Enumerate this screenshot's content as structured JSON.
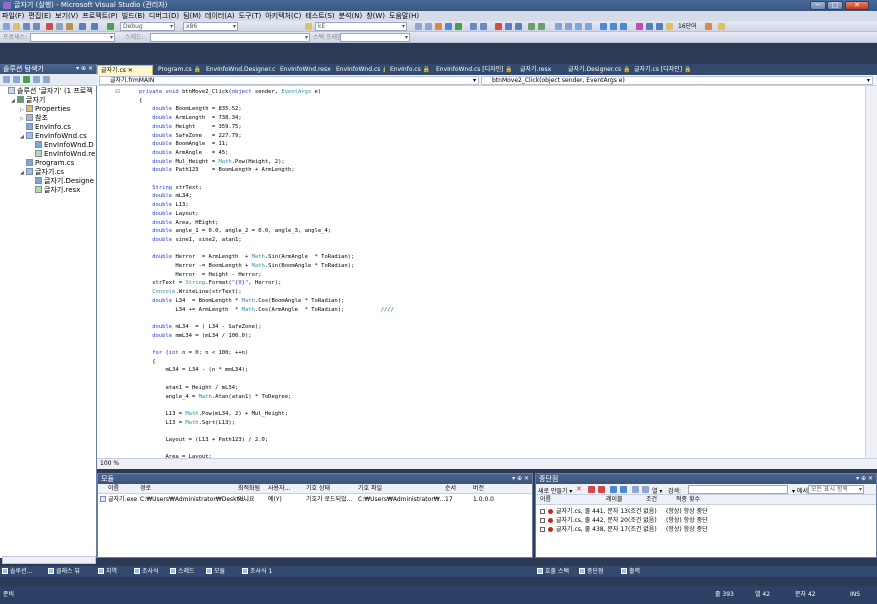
{
  "window": {
    "title": "글자기 (실행) - Microsoft Visual Studio (관리자)",
    "min_label": "─",
    "max_label": "□",
    "close_label": "✕"
  },
  "menu": [
    "파일(F)",
    "편집(E)",
    "보기(V)",
    "프로젝트(P)",
    "빌드(B)",
    "디버그(D)",
    "팀(M)",
    "데이터(A)",
    "도구(T)",
    "아키텍처(C)",
    "테스트(S)",
    "분석(N)",
    "창(W)",
    "도움말(H)"
  ],
  "toolbar": {
    "config_combo": "Debug",
    "platform_combo": "x86",
    "find_combo": "kE",
    "font_size_label": "16단어",
    "row3_combo1": "프로세스:",
    "row3_combo2": "스레드:",
    "row3_combo3": "스택 프레임:"
  },
  "solution_explorer": {
    "title": "솔루션 탐색기",
    "controls": "▾ ⊕ ✕",
    "nodes": [
      {
        "label": "솔루션 '글자기' (1 프로젝",
        "depth": 0,
        "icon": "solution-icon",
        "exp": ""
      },
      {
        "label": "글자기",
        "depth": 1,
        "icon": "project-icon",
        "exp": "◢"
      },
      {
        "label": "Properties",
        "depth": 2,
        "icon": "properties-icon",
        "exp": "▷"
      },
      {
        "label": "참조",
        "depth": 2,
        "icon": "references-icon",
        "exp": "▷"
      },
      {
        "label": "EnvInfo.cs",
        "depth": 2,
        "icon": "cs-file-icon",
        "exp": ""
      },
      {
        "label": "EnvInfoWnd.cs",
        "depth": 2,
        "icon": "form-icon",
        "exp": "◢"
      },
      {
        "label": "EnvInfoWnd.D",
        "depth": 3,
        "icon": "cs-file-icon",
        "exp": ""
      },
      {
        "label": "EnvInfoWnd.re",
        "depth": 3,
        "icon": "resx-icon",
        "exp": ""
      },
      {
        "label": "Program.cs",
        "depth": 2,
        "icon": "cs-file-icon",
        "exp": ""
      },
      {
        "label": "글자기.cs",
        "depth": 2,
        "icon": "form-icon",
        "exp": "◢"
      },
      {
        "label": "글자기.Designe",
        "depth": 3,
        "icon": "cs-file-icon",
        "exp": ""
      },
      {
        "label": "글자기.resx",
        "depth": 3,
        "icon": "resx-icon",
        "exp": ""
      }
    ]
  },
  "editor": {
    "tabs": [
      {
        "label": "글자기.cs ✕",
        "active": true
      },
      {
        "label": "Program.cs 🔒",
        "active": false
      },
      {
        "label": "EnvInfoWnd.Designer.cs 🔒",
        "active": false
      },
      {
        "label": "EnvInfoWnd.resx",
        "active": false
      },
      {
        "label": "EnvInfoWnd.cs 🔒",
        "active": false
      },
      {
        "label": "EnvInfo.cs 🔒",
        "active": false
      },
      {
        "label": "EnvInfoWnd.cs [디자인] 🔒",
        "active": false
      },
      {
        "label": "글자기.resx",
        "active": false
      },
      {
        "label": "글자기.Designer.cs 🔒",
        "active": false
      },
      {
        "label": "글자기.cs [디자인] 🔒",
        "active": false
      }
    ],
    "nav_left": "글자기.frmMAIN",
    "nav_right": "btnMove2_Click(object sender, EventArgs e)",
    "zoom": "100 %",
    "code_lines": [
      [
        [
          "kw",
          "private "
        ],
        [
          "kw",
          "void "
        ],
        [
          "",
          "btnMove2_Click("
        ],
        [
          "kw",
          "object "
        ],
        [
          "",
          "sender, "
        ],
        [
          "ty",
          "EventArgs "
        ],
        [
          "",
          "e)"
        ]
      ],
      [
        [
          "",
          "{"
        ]
      ],
      [
        [
          "kw",
          "    double "
        ],
        [
          "",
          "BoomLength = 835.52;"
        ]
      ],
      [
        [
          "kw",
          "    double "
        ],
        [
          "",
          "ArmLength  = 738.34;"
        ]
      ],
      [
        [
          "kw",
          "    double "
        ],
        [
          "",
          "Height     = 359.75;"
        ]
      ],
      [
        [
          "kw",
          "    double "
        ],
        [
          "",
          "SafeZone   = 227.79;"
        ]
      ],
      [
        [
          "kw",
          "    double "
        ],
        [
          "",
          "BoomAngle  = 11;"
        ]
      ],
      [
        [
          "kw",
          "    double "
        ],
        [
          "",
          "ArmAngle   = 45;"
        ]
      ],
      [
        [
          "kw",
          "    double "
        ],
        [
          "",
          "Mul_Height = "
        ],
        [
          "ty",
          "Math"
        ],
        [
          "",
          ".Pow(Height, 2);"
        ]
      ],
      [
        [
          "kw",
          "    double "
        ],
        [
          "",
          "Path123    = BoomLength + ArmLength;"
        ]
      ],
      [
        [
          "",
          ""
        ]
      ],
      [
        [
          "kw",
          "    String "
        ],
        [
          "",
          "strText;"
        ]
      ],
      [
        [
          "kw",
          "    double "
        ],
        [
          "",
          "mL34;"
        ]
      ],
      [
        [
          "kw",
          "    double "
        ],
        [
          "",
          "L13;"
        ]
      ],
      [
        [
          "kw",
          "    double "
        ],
        [
          "",
          "Layout;"
        ]
      ],
      [
        [
          "kw",
          "    double "
        ],
        [
          "",
          "Area, HEight;"
        ]
      ],
      [
        [
          "kw",
          "    double "
        ],
        [
          "",
          "angle_1 = 0.0, angle_2 = 0.0, angle_3, angle_4;"
        ]
      ],
      [
        [
          "kw",
          "    double "
        ],
        [
          "",
          "sine1, sine2, atan1;"
        ]
      ],
      [
        [
          "",
          ""
        ]
      ],
      [
        [
          "kw",
          "    double "
        ],
        [
          "",
          "Herror  = ArmLength  + "
        ],
        [
          "ty",
          "Math"
        ],
        [
          "",
          ".Sin(ArmAngle  * ToRadian);"
        ]
      ],
      [
        [
          "",
          "           Herror -= BoomLength + "
        ],
        [
          "ty",
          "Math"
        ],
        [
          "",
          ".Sin(BoomAngle * ToRadian);"
        ]
      ],
      [
        [
          "",
          "           Herror  = Height - Herror;"
        ]
      ],
      [
        [
          "",
          "    strText = "
        ],
        [
          "ty",
          "String"
        ],
        [
          "",
          ".Format("
        ],
        [
          "kw",
          "\"{0}\""
        ],
        [
          "",
          ", Herror);"
        ]
      ],
      [
        [
          "ty",
          "    Console"
        ],
        [
          "",
          ".WriteLine(strText);"
        ]
      ],
      [
        [
          "kw",
          "    double "
        ],
        [
          "",
          "L34  = BoomLength * "
        ],
        [
          "ty",
          "Math"
        ],
        [
          "",
          ".Cos(BoomAngle * ToRadian);"
        ]
      ],
      [
        [
          "",
          "           L34 += ArmLength  * "
        ],
        [
          "ty",
          "Math"
        ],
        [
          "",
          ".Cos(ArmAngle  * ToRadian);"
        ],
        [
          "cm",
          "           ////"
        ]
      ],
      [
        [
          "",
          ""
        ]
      ],
      [
        [
          "kw",
          "    double "
        ],
        [
          "",
          "mL34  = ( L34 - SafeZone);"
        ]
      ],
      [
        [
          "kw",
          "    double "
        ],
        [
          "",
          "mmL34 = (mL34 / 100.0);"
        ]
      ],
      [
        [
          "",
          ""
        ]
      ],
      [
        [
          "kw",
          "    for "
        ],
        [
          "",
          "("
        ],
        [
          "kw",
          "int "
        ],
        [
          "",
          "n = 0; n < 100; ++n)"
        ]
      ],
      [
        [
          "",
          "    {"
        ]
      ],
      [
        [
          "",
          "        mL34 = L34 - (n * mmL34);"
        ]
      ],
      [
        [
          "",
          ""
        ]
      ],
      [
        [
          "",
          "        atan1 = Height / mL34;"
        ]
      ],
      [
        [
          "",
          "        angle_4 = "
        ],
        [
          "ty",
          "Math"
        ],
        [
          "",
          ".Atan(atan1) * ToDegree;"
        ]
      ],
      [
        [
          "",
          ""
        ]
      ],
      [
        [
          "",
          "        L13 = "
        ],
        [
          "ty",
          "Math"
        ],
        [
          "",
          ".Pow(mL34, 2) + Mul_Height;"
        ]
      ],
      [
        [
          "",
          "        L13 = "
        ],
        [
          "ty",
          "Math"
        ],
        [
          "",
          ".Sqrt(L13);"
        ]
      ],
      [
        [
          "",
          ""
        ]
      ],
      [
        [
          "",
          "        Layout = (L13 + Path123) / 2.0;"
        ]
      ],
      [
        [
          "",
          ""
        ]
      ],
      [
        [
          "",
          "        Area = Layout;"
        ]
      ]
    ]
  },
  "output_panel": {
    "title": "모듈",
    "controls": "▾ ⊕ ✕",
    "columns": [
      "이름",
      "경로",
      "최적화됨",
      "사용자...",
      "기호 상태",
      "기호 파일",
      "순서",
      "버전"
    ],
    "rows": [
      [
        "글자기.exe",
        "C:₩Users₩Administrator₩Deskto...",
        "아니요",
        "예(Y)",
        "기호가 로드되었...",
        "C:₩Users₩Administrator₩...",
        "17",
        "1.0.0.0"
      ]
    ]
  },
  "breakpoint_panel": {
    "title": "중단점",
    "controls": "▾ ⊕ ✕",
    "toolbar_new": "새로 만들기 ▾",
    "toolbar_columns": "열 ▾",
    "search_label": "검색:",
    "in_column_label": "▾ 에서",
    "in_column_value": "모든 표시 항목",
    "columns": [
      "이름",
      "레이블",
      "조건",
      "적중 횟수"
    ],
    "rows": [
      [
        "글자기.cs, 줄 441, 문자 13",
        "(조건 없음)",
        "(항상) 항상 중단"
      ],
      [
        "글자기.cs, 줄 442, 문자 20",
        "(조건 없음)",
        "(항상) 항상 중단"
      ],
      [
        "글자기.cs, 줄 438, 문자 17",
        "(조건 없음)",
        "(항상) 항상 중단"
      ]
    ]
  },
  "bottom_tabs_left": [
    "솔루션...",
    "클래스 뷰"
  ],
  "bottom_tabs_mid": [
    "지역",
    "조사식",
    "스레드",
    "모듈",
    "조사식 1"
  ],
  "bottom_tabs_right": [
    "호출 스택",
    "중단점",
    "출력"
  ],
  "status": {
    "left": "준비",
    "line": "줄 393",
    "col": "열 42",
    "char": "문자 42",
    "mode": "INS"
  }
}
